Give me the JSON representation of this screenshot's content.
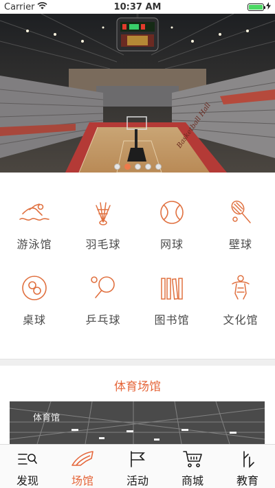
{
  "status_bar": {
    "carrier": "Carrier",
    "time": "10:37 AM",
    "battery_level": 1.0
  },
  "banner": {
    "slide_count": 5,
    "active_index": 1,
    "scoreboard_text": "",
    "floor_text": "Basketball Hall"
  },
  "categories": [
    {
      "label": "游泳馆",
      "icon": "swimming-icon"
    },
    {
      "label": "羽毛球",
      "icon": "badminton-icon"
    },
    {
      "label": "网球",
      "icon": "tennis-icon"
    },
    {
      "label": "壁球",
      "icon": "squash-icon"
    },
    {
      "label": "桌球",
      "icon": "billiards-icon"
    },
    {
      "label": "乒乓球",
      "icon": "ping-pong-icon"
    },
    {
      "label": "图书馆",
      "icon": "library-icon"
    },
    {
      "label": "文化馆",
      "icon": "culture-icon"
    }
  ],
  "section": {
    "title": "体育场馆"
  },
  "venue_card": {
    "label": "体育馆"
  },
  "tabbar": {
    "tabs": [
      {
        "label": "发现",
        "icon": "discover-icon",
        "active": false
      },
      {
        "label": "场馆",
        "icon": "venue-icon",
        "active": true
      },
      {
        "label": "活动",
        "icon": "activity-flag-icon",
        "active": false
      },
      {
        "label": "商城",
        "icon": "shop-cart-icon",
        "active": false
      },
      {
        "label": "教育",
        "icon": "education-icon",
        "active": false
      }
    ]
  },
  "colors": {
    "accent": "#e5663a",
    "icon_orange": "#e0703f",
    "divider": "#efefef"
  }
}
